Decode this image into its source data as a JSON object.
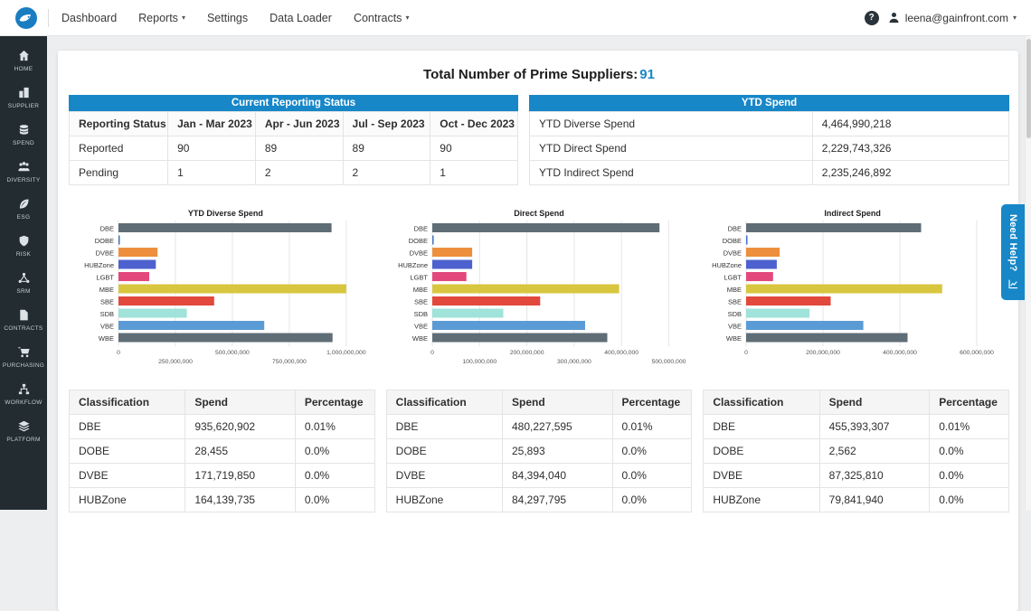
{
  "topbar": {
    "nav": [
      {
        "label": "Dashboard",
        "caret": false
      },
      {
        "label": "Reports",
        "caret": true
      },
      {
        "label": "Settings",
        "caret": false
      },
      {
        "label": "Data Loader",
        "caret": false
      },
      {
        "label": "Contracts",
        "caret": true
      }
    ],
    "right": {
      "help_glyph": "?",
      "email": "leena@gainfront.com"
    }
  },
  "sidebar": {
    "items": [
      {
        "label": "HOME",
        "icon": "home"
      },
      {
        "label": "SUPPLIER",
        "icon": "supplier"
      },
      {
        "label": "SPEND",
        "icon": "spend"
      },
      {
        "label": "DIVERSITY",
        "icon": "diversity"
      },
      {
        "label": "ESG",
        "icon": "esg"
      },
      {
        "label": "RISK",
        "icon": "risk"
      },
      {
        "label": "SRM",
        "icon": "srm"
      },
      {
        "label": "CONTRACTS",
        "icon": "contracts"
      },
      {
        "label": "PURCHASING",
        "icon": "purchasing"
      },
      {
        "label": "WORKFLOW",
        "icon": "workflow"
      },
      {
        "label": "PLATFORM",
        "icon": "platform"
      }
    ]
  },
  "summary": {
    "title": "Total Number of Prime Suppliers:",
    "value": "91"
  },
  "reporting_status": {
    "header": "Current Reporting Status",
    "columns": [
      "Reporting Status",
      "Jan - Mar 2023",
      "Apr - Jun 2023",
      "Jul - Sep 2023",
      "Oct - Dec 2023"
    ],
    "rows": [
      [
        "Reported",
        "90",
        "89",
        "89",
        "90"
      ],
      [
        "Pending",
        "1",
        "2",
        "2",
        "1"
      ]
    ]
  },
  "ytd_spend": {
    "header": "YTD Spend",
    "rows": [
      [
        "YTD Diverse Spend",
        "4,464,990,218"
      ],
      [
        "YTD Direct Spend",
        "2,229,743,326"
      ],
      [
        "YTD Indirect Spend",
        "2,235,246,892"
      ]
    ]
  },
  "chart_data": [
    {
      "type": "bar",
      "orientation": "horizontal",
      "title": "YTD Diverse Spend",
      "categories": [
        "DBE",
        "DOBE",
        "DVBE",
        "HUBZone",
        "LGBT",
        "MBE",
        "SBE",
        "SDB",
        "VBE",
        "WBE"
      ],
      "values": [
        935620902,
        28455,
        171719850,
        164139735,
        135000000,
        1000000000,
        420000000,
        300000000,
        640000000,
        940000000
      ],
      "bar_colors": [
        "#5f6d77",
        "#4472c4",
        "#ed8f3d",
        "#4d62cf",
        "#e2487c",
        "#d9c63f",
        "#e2483c",
        "#9fe3da",
        "#5b9bd5",
        "#5f6d77"
      ],
      "xticks": [
        0,
        250000000,
        500000000,
        750000000,
        1000000000
      ],
      "xmax": 1080000000,
      "stagger_ticks": true,
      "grid": true,
      "legend": false
    },
    {
      "type": "bar",
      "orientation": "horizontal",
      "title": "Direct Spend",
      "categories": [
        "DBE",
        "DOBE",
        "DVBE",
        "HUBZone",
        "LGBT",
        "MBE",
        "SBE",
        "SDB",
        "VBE",
        "WBE"
      ],
      "values": [
        480227595,
        25893,
        84394040,
        84297795,
        72000000,
        395000000,
        228000000,
        150000000,
        323000000,
        370000000
      ],
      "bar_colors": [
        "#5f6d77",
        "#4472c4",
        "#ed8f3d",
        "#4d62cf",
        "#e2487c",
        "#d9c63f",
        "#e2483c",
        "#9fe3da",
        "#5b9bd5",
        "#5f6d77"
      ],
      "xticks": [
        0,
        100000000,
        200000000,
        300000000,
        400000000,
        500000000
      ],
      "xmax": 520000000,
      "stagger_ticks": true,
      "grid": true,
      "legend": false
    },
    {
      "type": "bar",
      "orientation": "horizontal",
      "title": "Indirect Spend",
      "categories": [
        "DBE",
        "DOBE",
        "DVBE",
        "HUBZone",
        "LGBT",
        "MBE",
        "SBE",
        "SDB",
        "VBE",
        "WBE"
      ],
      "values": [
        455393307,
        2562,
        87325810,
        79841940,
        70000000,
        510000000,
        220000000,
        165000000,
        305000000,
        420000000
      ],
      "bar_colors": [
        "#5f6d77",
        "#4472c4",
        "#ed8f3d",
        "#4d62cf",
        "#e2487c",
        "#d9c63f",
        "#e2483c",
        "#9fe3da",
        "#5b9bd5",
        "#5f6d77"
      ],
      "xticks": [
        0,
        200000000,
        400000000,
        600000000
      ],
      "xmax": 640000000,
      "stagger_ticks": false,
      "grid": true,
      "legend": false
    }
  ],
  "classification_tables": [
    {
      "columns": [
        "Classification",
        "Spend",
        "Percentage"
      ],
      "rows": [
        [
          "DBE",
          "935,620,902",
          "0.01%"
        ],
        [
          "DOBE",
          "28,455",
          "0.0%"
        ],
        [
          "DVBE",
          "171,719,850",
          "0.0%"
        ],
        [
          "HUBZone",
          "164,139,735",
          "0.0%"
        ]
      ]
    },
    {
      "columns": [
        "Classification",
        "Spend",
        "Percentage"
      ],
      "rows": [
        [
          "DBE",
          "480,227,595",
          "0.01%"
        ],
        [
          "DOBE",
          "25,893",
          "0.0%"
        ],
        [
          "DVBE",
          "84,394,040",
          "0.0%"
        ],
        [
          "HUBZone",
          "84,297,795",
          "0.0%"
        ]
      ]
    },
    {
      "columns": [
        "Classification",
        "Spend",
        "Percentage"
      ],
      "rows": [
        [
          "DBE",
          "455,393,307",
          "0.01%"
        ],
        [
          "DOBE",
          "2,562",
          "0.0%"
        ],
        [
          "DVBE",
          "87,325,810",
          "0.0%"
        ],
        [
          "HUBZone",
          "79,841,940",
          "0.0%"
        ]
      ]
    }
  ],
  "help_tab": {
    "label": "Need Help?"
  },
  "colors": {
    "accent": "#1787c8",
    "sidebar_bg": "#222c31"
  }
}
